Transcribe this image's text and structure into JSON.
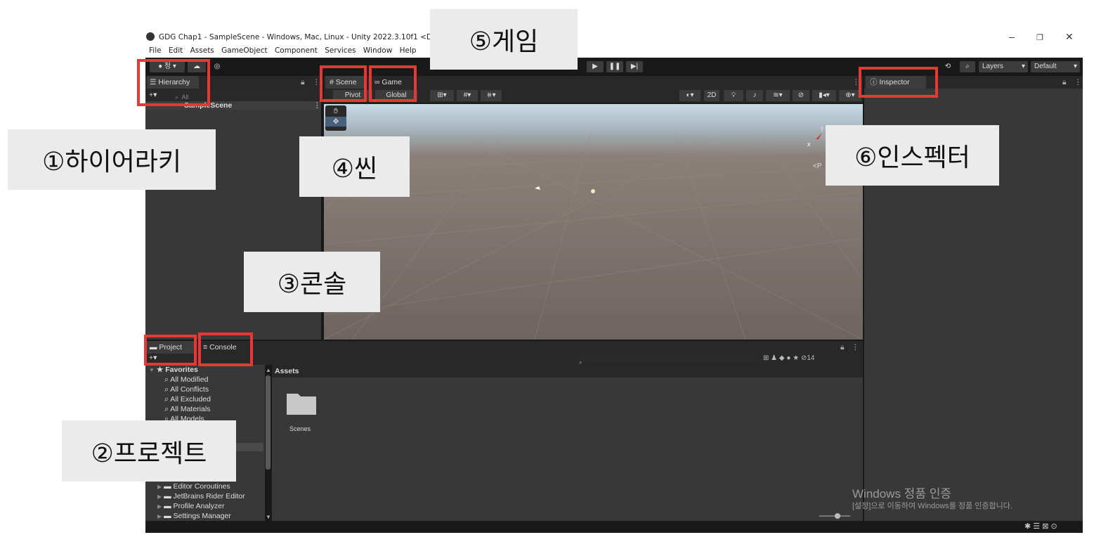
{
  "window": {
    "title": "GDG Chap1 - SampleScene - Windows, Mac, Linux - Unity 2022.3.10f1 <DX11>",
    "controls": [
      "–",
      "❐",
      "✕"
    ]
  },
  "menu": [
    "File",
    "Edit",
    "Assets",
    "GameObject",
    "Component",
    "Services",
    "Window",
    "Help"
  ],
  "toolbar": {
    "account_label": "정 ▾",
    "layers_label": "Layers",
    "layout_label": "Default"
  },
  "hierarchy": {
    "tab": "Hierarchy",
    "search_placeholder": "All",
    "scene_name": "SampleScene"
  },
  "scene_view": {
    "tab_scene": "Scene",
    "tab_game": "Game",
    "btn_2d": "2D",
    "pivot_label": "Pivot",
    "global_label": "Global",
    "persp_label": "<P"
  },
  "inspector": {
    "tab": "Inspector"
  },
  "project": {
    "tab_project": "Project",
    "tab_console": "Console",
    "favorites_label": "Favorites",
    "favorites": [
      "All Modified",
      "All Conflicts",
      "All Excluded",
      "All Materials",
      "All Models"
    ],
    "packages": [
      "Editor Coroutines",
      "JetBrains Rider Editor",
      "Profile Analyzer",
      "Settings Manager"
    ],
    "assets_header": "Assets",
    "folder_name": "Scenes",
    "hidden_count": "14"
  },
  "annotations": {
    "hierarchy": "①하이어라키",
    "project": "②프로젝트",
    "console": "③콘솔",
    "scene": "④씬",
    "game": "⑤게임",
    "inspector": "⑥인스펙터"
  },
  "watermark": {
    "title": "Windows 정품 인증",
    "subtitle": "[설정]으로 이동하여 Windows를 정품 인증합니다."
  },
  "colors": {
    "annotation_border": "#e53935",
    "editor_bg": "#191919",
    "panel_bg": "#383838"
  }
}
